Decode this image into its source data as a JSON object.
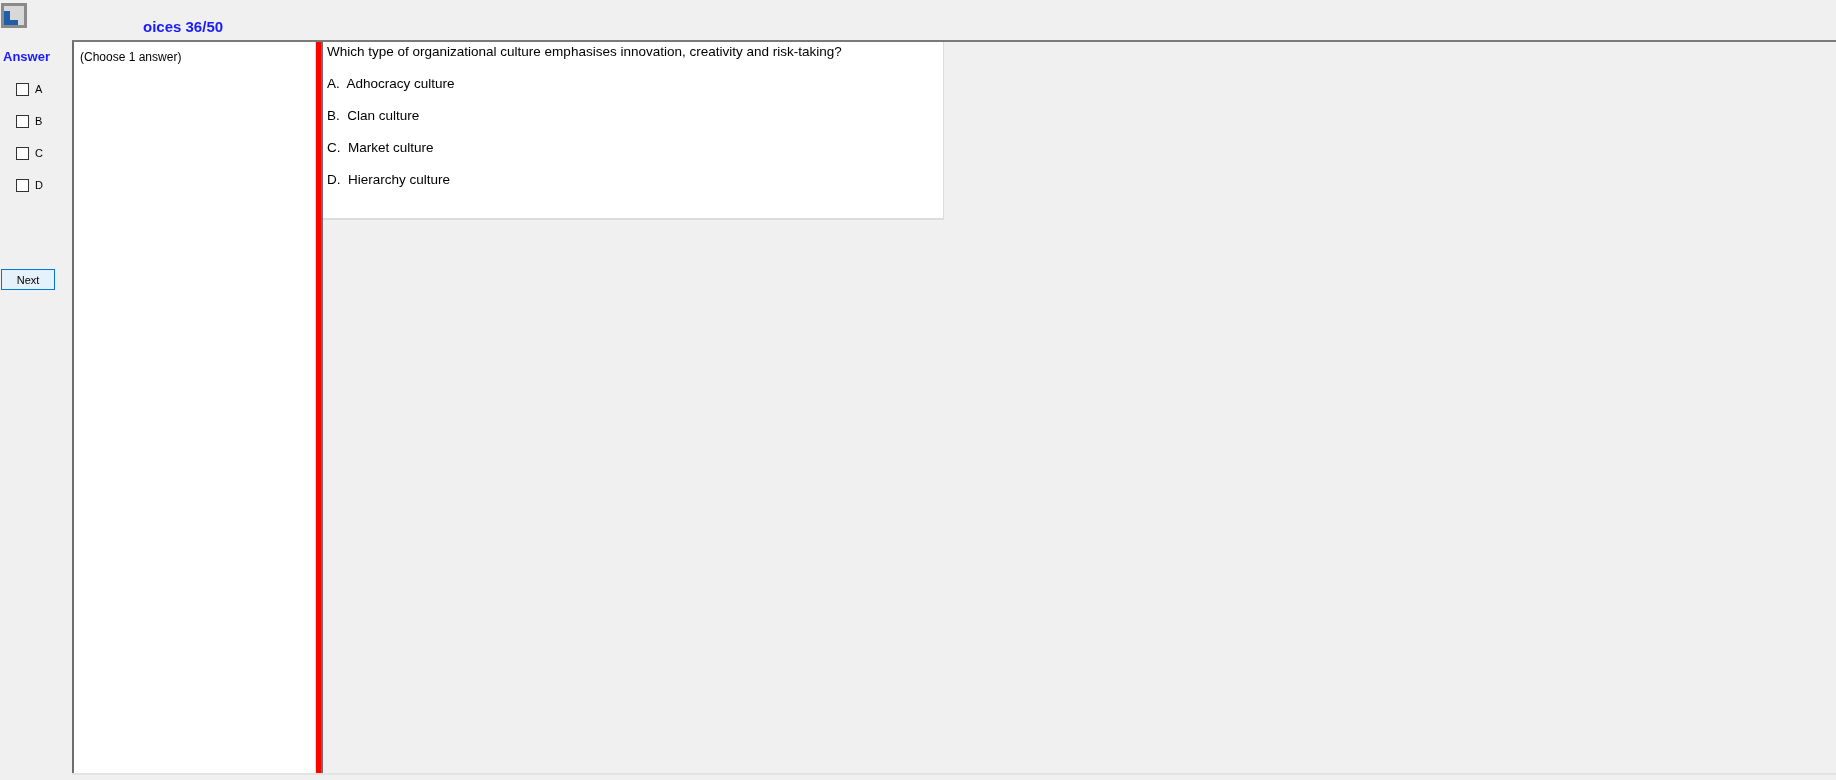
{
  "window": {
    "title": "oices 36/50"
  },
  "answer_panel": {
    "heading": "Answer",
    "options": [
      {
        "label": "A",
        "checked": false
      },
      {
        "label": "B",
        "checked": false
      },
      {
        "label": "C",
        "checked": false
      },
      {
        "label": "D",
        "checked": false
      }
    ],
    "next_button": "Next"
  },
  "instruction": "(Choose 1 answer)",
  "question": {
    "text": "Which type of organizational culture emphasises innovation, creativity and risk-taking?",
    "choices": [
      "A.  Adhocracy culture",
      "B.  Clan culture",
      "C.  Market culture",
      "D.  Hierarchy culture"
    ]
  }
}
